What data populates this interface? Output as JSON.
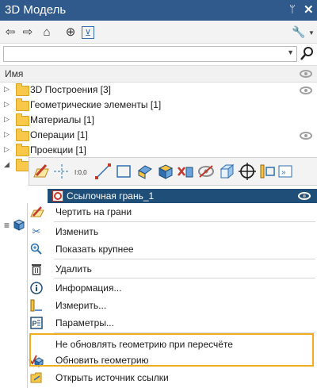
{
  "window": {
    "title": "3D Модель",
    "pin_glyph": "ᛘ",
    "close_glyph": "✕"
  },
  "toolbar": {
    "back": "⇦",
    "forward": "⇨",
    "home": "⌂",
    "target": "⊕",
    "filter": "⊻",
    "wrench": "🔧"
  },
  "search": {
    "value": "",
    "placeholder": ""
  },
  "column_header": "Имя",
  "tree": [
    {
      "label": "3D Построения [3]",
      "eye": true
    },
    {
      "label": "Геометрические элементы [1]",
      "eye": false
    },
    {
      "label": "Материалы [1]",
      "eye": false
    },
    {
      "label": "Операции [1]",
      "eye": true
    },
    {
      "label": "Проекции [1]",
      "eye": false
    }
  ],
  "selected_item": {
    "label": "Ссылочная грань_1"
  },
  "context_menu": [
    {
      "label": "Чертить на грани",
      "icon": "pencil-icon"
    },
    {
      "label": "Изменить",
      "icon": "edit-icon"
    },
    {
      "label": "Показать крупнее",
      "icon": "zoom-icon"
    },
    {
      "label": "Удалить",
      "icon": "trash-icon"
    },
    {
      "label": "Информация...",
      "icon": "info-icon"
    },
    {
      "label": "Измерить...",
      "icon": "ruler-icon"
    },
    {
      "label": "Параметры...",
      "icon": "params-icon"
    },
    {
      "label": "Не обновлять геометрию при пересчёте",
      "icon": ""
    },
    {
      "label": "Обновить геометрию",
      "icon": "update-geometry-icon"
    },
    {
      "label": "Открыть источник ссылки",
      "icon": "open-source-icon"
    }
  ],
  "colors": {
    "title_bar": "#2f5a8b",
    "selection": "#1f4e78",
    "highlight_frame": "#f0ad1e",
    "folder": "#f7c84a"
  }
}
